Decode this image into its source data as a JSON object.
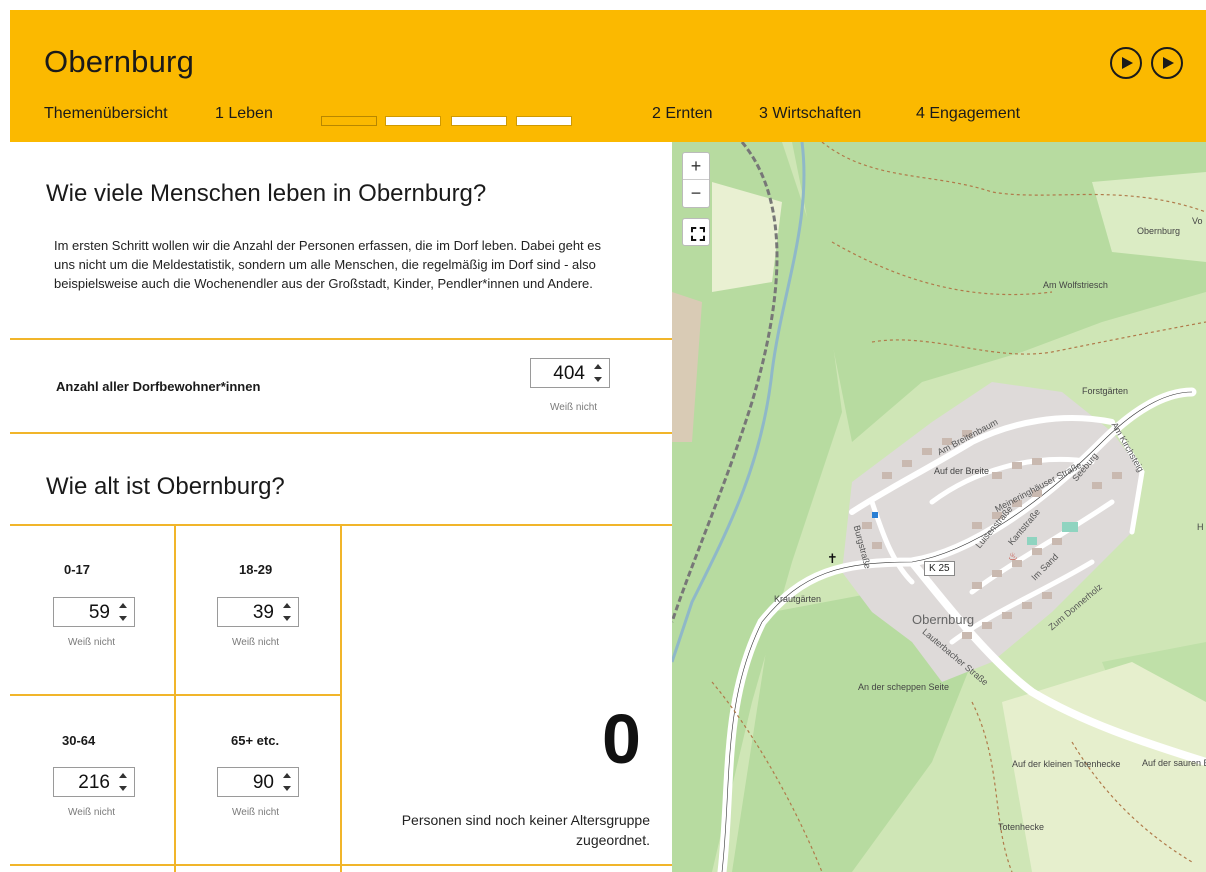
{
  "header": {
    "title": "Obernburg",
    "nav": {
      "overview": "Themenübersicht",
      "leben": "1  Leben",
      "ernten": "2  Ernten",
      "wirtschaften": "3  Wirtschaften",
      "engagement": "4  Engagement"
    },
    "progress": {
      "steps_total": 4,
      "current_step": 1
    }
  },
  "section_people": {
    "heading": "Wie viele Menschen leben in Obernburg?",
    "intro": "Im ersten Schritt wollen wir die Anzahl der Personen erfassen, die im Dorf leben. Dabei geht es uns nicht um die Meldestatistik, sondern um alle Menschen, die regelmäßig im Dorf sind - also beispielsweise auch die Wochenendler aus der Großstadt, Kinder, Pendler*innen und Andere.",
    "field_label": "Anzahl aller Dorfbewohner*innen",
    "value": "404",
    "unknown": "Weiß nicht"
  },
  "section_age": {
    "heading": "Wie alt ist Obernburg?",
    "groups": [
      {
        "label": "0-17",
        "value": "59",
        "unknown": "Weiß nicht"
      },
      {
        "label": "18-29",
        "value": "39",
        "unknown": "Weiß nicht"
      },
      {
        "label": "30-64",
        "value": "216",
        "unknown": "Weiß nicht"
      },
      {
        "label": "65+ etc.",
        "value": "90",
        "unknown": "Weiß nicht"
      }
    ],
    "unassigned_count": "0",
    "unassigned_text": "Personen sind noch keiner Altersgruppe zugeordnet."
  },
  "map": {
    "zoom_in": "+",
    "zoom_out": "−",
    "labels": {
      "place": "Obernburg",
      "place_small": "Obernburg",
      "wolfstriesch": "Am Wolfstriesch",
      "forstgaerten": "Forstgärten",
      "breitenbaum": "Am Breitenbaum",
      "auf_der_breite": "Auf der Breite",
      "meineringhaeuser": "Meineringhäuser Straße",
      "luisenstrasse": "Luisenstraße",
      "kantstrasse": "Kantstraße",
      "seeburg": "Seeburg",
      "am_kirchsteig": "Am Kirchsteig",
      "im_sand": "Im Sand",
      "zum_donnerholz": "Zum Donnerholz",
      "burgstrasse": "Burgstraße",
      "lauterbacher": "Lauterbacher Straße",
      "krautgaerten": "Krautgärten",
      "scheppen": "An der scheppen Seite",
      "kleinen_totenhecke": "Auf der kleinen Totenhecke",
      "saure_breite": "Auf der sauren Breite",
      "totenhecke": "Totenhecke",
      "k25": "K 25",
      "vo": "Vo",
      "h": "H"
    }
  }
}
